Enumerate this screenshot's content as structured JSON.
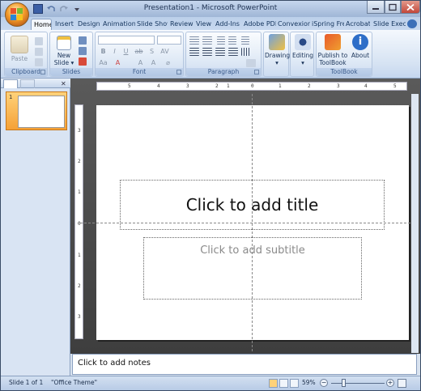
{
  "window": {
    "title": "Presentation1 - Microsoft PowerPoint"
  },
  "tabs": [
    "Home",
    "Insert",
    "Design",
    "Animation",
    "Slide Show",
    "Review",
    "View",
    "Add-Ins",
    "Adobe PDF",
    "Convexion",
    "iSpring Free",
    "Acrobat",
    "Slide Executive"
  ],
  "active_tab": "Home",
  "ribbon": {
    "clipboard": {
      "label": "Clipboard",
      "paste": "Paste"
    },
    "slides": {
      "label": "Slides",
      "new_slide_line1": "New",
      "new_slide_line2": "Slide ▾"
    },
    "font": {
      "label": "Font"
    },
    "paragraph": {
      "label": "Paragraph"
    },
    "drawing": {
      "label": "Drawing"
    },
    "editing": {
      "label": "Editing"
    },
    "toolbook": {
      "label": "ToolBook",
      "publish_line1": "Publish to",
      "publish_line2": "ToolBook",
      "about": "About"
    }
  },
  "slide_pane": {
    "thumb_number": "1"
  },
  "slide": {
    "title_placeholder": "Click to add title",
    "subtitle_placeholder": "Click to add subtitle"
  },
  "notes": {
    "placeholder": "Click to add notes"
  },
  "status": {
    "slide": "Slide 1 of 1",
    "theme": "\"Office Theme\"",
    "zoom": "59%"
  },
  "ruler": {
    "h": [
      "5",
      "4",
      "3",
      "2",
      "1",
      "0",
      "1",
      "2",
      "3",
      "4",
      "5"
    ],
    "v": [
      "3",
      "2",
      "1",
      "0",
      "1",
      "2",
      "3"
    ]
  },
  "colors": {
    "accent": "#f5a136",
    "ribbon": "#d6e3f3",
    "workspace": "#4a4a4a"
  }
}
